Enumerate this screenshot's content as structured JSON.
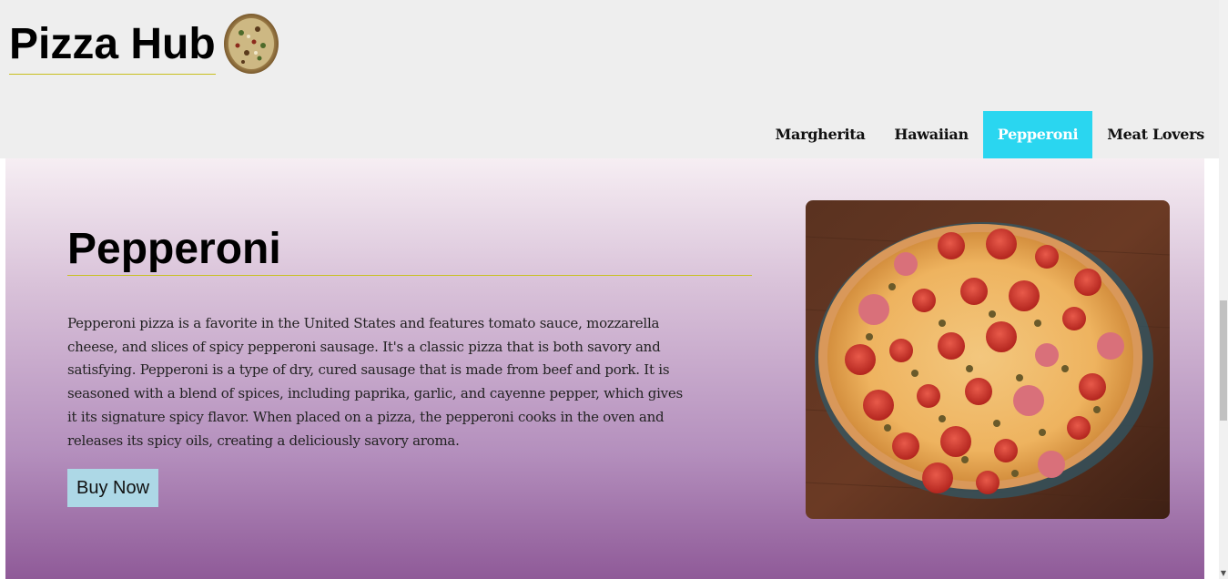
{
  "header": {
    "logo_title": "Pizza Hub",
    "logo_icon": "pizza-icon"
  },
  "nav": {
    "items": [
      {
        "label": "Margherita",
        "active": false
      },
      {
        "label": "Hawaiian",
        "active": false
      },
      {
        "label": "Pepperoni",
        "active": true
      },
      {
        "label": "Meat Lovers",
        "active": false
      }
    ]
  },
  "main": {
    "title": "Pepperoni",
    "description": "Pepperoni pizza is a favorite in the United States and features tomato sauce, mozzarella cheese, and slices of spicy pepperoni sausage. It's a classic pizza that is both savory and satisfying. Pepperoni is a type of dry, cured sausage that is made from beef and pork. It is seasoned with a blend of spices, including paprika, garlic, and cayenne pepper, which gives it its signature spicy flavor. When placed on a pizza, the pepperoni cooks in the oven and releases its spicy oils, creating a deliciously savory aroma.",
    "buy_label": "Buy Now",
    "photo": "pepperoni-pizza-photo"
  },
  "colors": {
    "header_bg": "#eeeeee",
    "nav_active": "#2ad6f0",
    "button_bg": "#add8e6",
    "gradient_top": "#f6eef3",
    "gradient_bottom": "#8f5a98"
  }
}
